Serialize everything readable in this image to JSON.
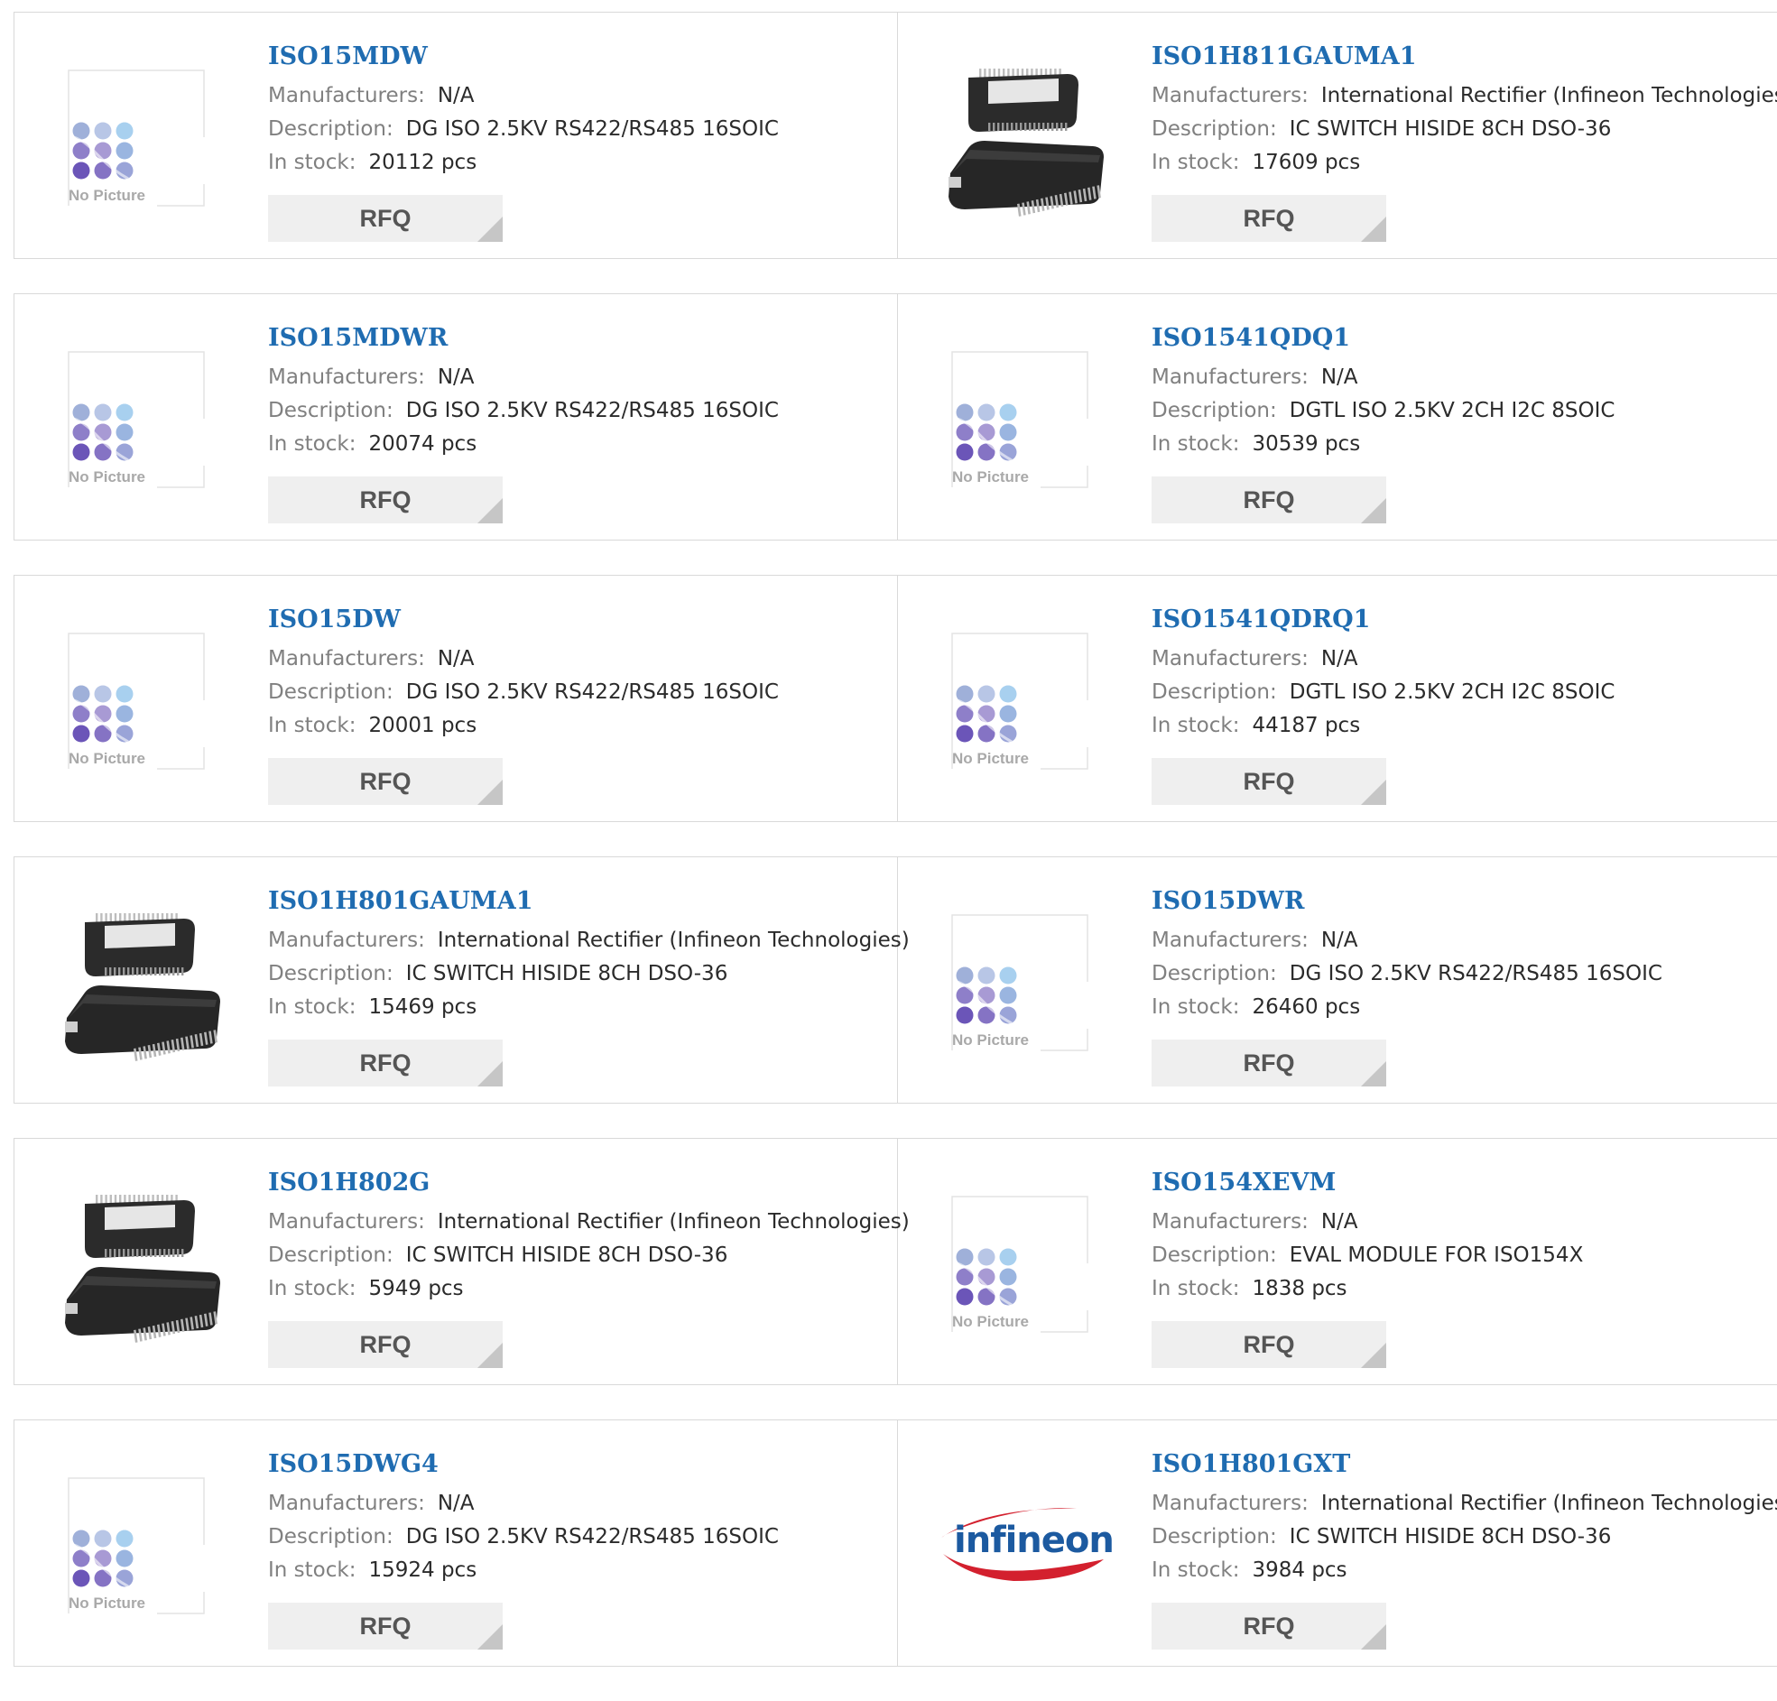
{
  "labels": {
    "manufacturers": "Manufacturers:",
    "description": "Description:",
    "in_stock": "In stock:",
    "rfq": "RFQ",
    "no_picture": "No Picture",
    "brand_text": "infineon"
  },
  "colors": {
    "part_link": "#1f6cb1",
    "label_gray": "#808080",
    "value_text": "#2b2b2b",
    "rfq_bg": "#efefef",
    "border": "#d9d9d9"
  },
  "products": [
    {
      "part": "ISO15MDW",
      "manufacturer": "N/A",
      "description": "DG ISO 2.5KV RS422/RS485 16SOIC",
      "stock": "20112 pcs",
      "image": "no-picture"
    },
    {
      "part": "ISO1H811GAUMA1",
      "manufacturer": "International Rectifier (Infineon Technologies)",
      "description": "IC SWITCH HISIDE 8CH DSO-36",
      "stock": "17609 pcs",
      "image": "chip-package"
    },
    {
      "part": "ISO15MDWR",
      "manufacturer": "N/A",
      "description": "DG ISO 2.5KV RS422/RS485 16SOIC",
      "stock": "20074 pcs",
      "image": "no-picture"
    },
    {
      "part": "ISO1541QDQ1",
      "manufacturer": "N/A",
      "description": "DGTL ISO 2.5KV 2CH I2C 8SOIC",
      "stock": "30539 pcs",
      "image": "no-picture"
    },
    {
      "part": "ISO15DW",
      "manufacturer": "N/A",
      "description": "DG ISO 2.5KV RS422/RS485 16SOIC",
      "stock": "20001 pcs",
      "image": "no-picture"
    },
    {
      "part": "ISO1541QDRQ1",
      "manufacturer": "N/A",
      "description": "DGTL ISO 2.5KV 2CH I2C 8SOIC",
      "stock": "44187 pcs",
      "image": "no-picture"
    },
    {
      "part": "ISO1H801GAUMA1",
      "manufacturer": "International Rectifier (Infineon Technologies)",
      "description": "IC SWITCH HISIDE 8CH DSO-36",
      "stock": "15469 pcs",
      "image": "chip-package"
    },
    {
      "part": "ISO15DWR",
      "manufacturer": "N/A",
      "description": "DG ISO 2.5KV RS422/RS485 16SOIC",
      "stock": "26460 pcs",
      "image": "no-picture"
    },
    {
      "part": "ISO1H802G",
      "manufacturer": "International Rectifier (Infineon Technologies)",
      "description": "IC SWITCH HISIDE 8CH DSO-36",
      "stock": "5949 pcs",
      "image": "chip-package"
    },
    {
      "part": "ISO154XEVM",
      "manufacturer": "N/A",
      "description": "EVAL MODULE FOR ISO154X",
      "stock": "1838 pcs",
      "image": "no-picture"
    },
    {
      "part": "ISO15DWG4",
      "manufacturer": "N/A",
      "description": "DG ISO 2.5KV RS422/RS485 16SOIC",
      "stock": "15924 pcs",
      "image": "no-picture"
    },
    {
      "part": "ISO1H801GXT",
      "manufacturer": "International Rectifier (Infineon Technologies)",
      "description": "IC SWITCH HISIDE 8CH DSO-36",
      "stock": "3984 pcs",
      "image": "infineon-logo"
    }
  ]
}
